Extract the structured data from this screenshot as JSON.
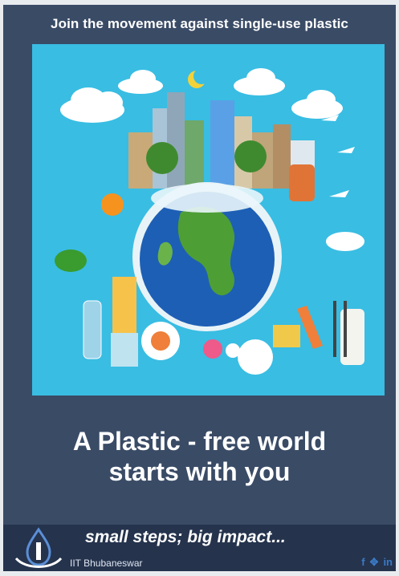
{
  "header": {
    "title": "Join the movement against single-use plastic"
  },
  "headline": {
    "line1": "A Plastic - free world",
    "line2": "starts with you"
  },
  "footer": {
    "tagline": "small steps; big impact...",
    "institution": "IIT Bhubaneswar",
    "social": [
      {
        "name": "facebook-icon",
        "glyph": "f"
      },
      {
        "name": "twitter-icon",
        "glyph": "✥"
      },
      {
        "name": "linkedin-icon",
        "glyph": "in"
      }
    ]
  },
  "colors": {
    "background": "#3a4b66",
    "poster_bg": "#39bde3",
    "band": "#25334d",
    "text": "#ffffff"
  }
}
